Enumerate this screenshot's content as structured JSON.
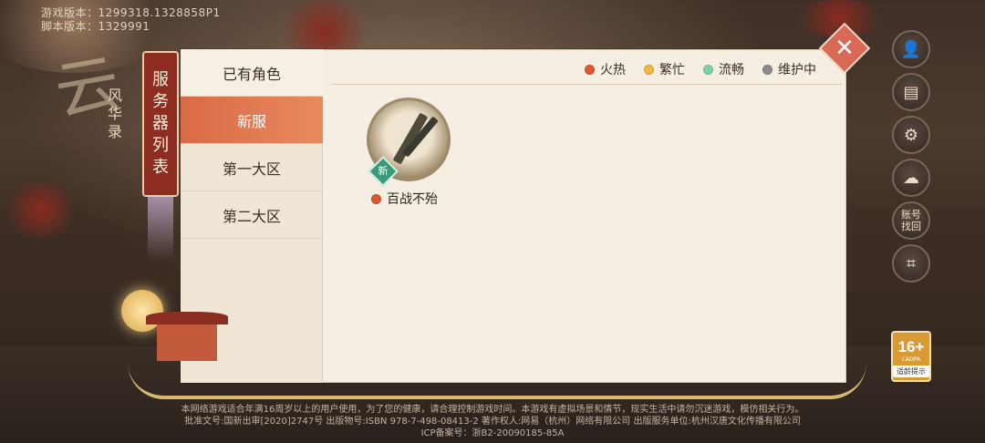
{
  "version": {
    "game_version": "游戏版本：1299318.1328858P1",
    "script_version": "脚本版本：1329991"
  },
  "brand": {
    "tag": "风华录"
  },
  "banner": {
    "title_chars": [
      "服",
      "务",
      "器",
      "列",
      "表"
    ]
  },
  "tabs": [
    {
      "label": "已有角色",
      "active": false
    },
    {
      "label": "新服",
      "active": true
    },
    {
      "label": "第一大区",
      "active": false
    },
    {
      "label": "第二大区",
      "active": false
    }
  ],
  "legend": [
    {
      "label": "火热",
      "color": "#e0582d"
    },
    {
      "label": "繁忙",
      "color": "#f2b844"
    },
    {
      "label": "流畅",
      "color": "#7cd3a8"
    },
    {
      "label": "维护中",
      "color": "#8c8c8c"
    }
  ],
  "server": {
    "name": "百战不殆",
    "badge": "新",
    "status_color": "#e0582d"
  },
  "close": {
    "symbol": "✕"
  },
  "side_icons": [
    {
      "name": "user-icon",
      "glyph": "👤"
    },
    {
      "name": "notice-icon",
      "glyph": "▤"
    },
    {
      "name": "settings-gear-icon",
      "glyph": "⚙"
    },
    {
      "name": "cloud-download-icon",
      "glyph": "☁"
    },
    {
      "name": "account-retrieve-icon",
      "text": "账号找回"
    },
    {
      "name": "scan-icon",
      "glyph": "⌗"
    }
  ],
  "age_rating": {
    "number": "16+",
    "org": "CADPA",
    "tip": "适龄提示"
  },
  "footer": {
    "line1": "本网络游戏适合年满16周岁以上的用户使用，为了您的健康，请合理控制游戏时间。本游戏有虚拟场景和情节，现实生活中请勿沉迷游戏，模仿相关行为。",
    "line2": "批准文号:国新出审[2020]2747号   出版物号:ISBN 978-7-498-08413-2   著作权人:网易（杭州）网络有限公司   出版服务单位:杭州汉唐文化传播有限公司",
    "line3": "ICP备案号：浙B2-20090185-85A"
  }
}
